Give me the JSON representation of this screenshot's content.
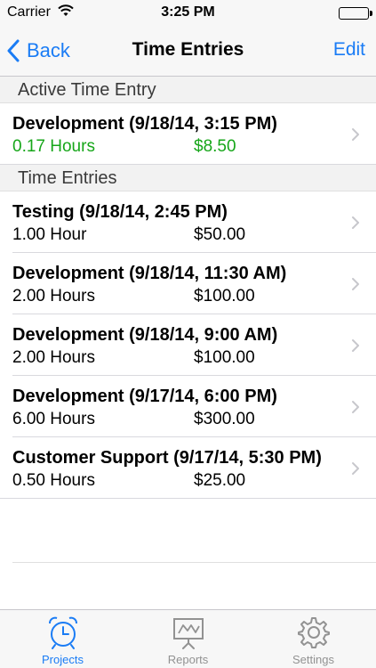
{
  "status_bar": {
    "carrier": "Carrier",
    "time": "3:25 PM"
  },
  "nav": {
    "back_label": "Back",
    "title": "Time Entries",
    "edit_label": "Edit"
  },
  "sections": {
    "active": {
      "header": "Active Time Entry",
      "entries": [
        {
          "title": "Development (9/18/14, 3:15 PM)",
          "hours": "0.17 Hours",
          "amount": "$8.50"
        }
      ]
    },
    "entries": {
      "header": "Time Entries",
      "entries": [
        {
          "title": "Testing (9/18/14, 2:45 PM)",
          "hours": "1.00 Hour",
          "amount": "$50.00"
        },
        {
          "title": "Development (9/18/14, 11:30 AM)",
          "hours": "2.00 Hours",
          "amount": "$100.00"
        },
        {
          "title": "Development (9/18/14, 9:00 AM)",
          "hours": "2.00 Hours",
          "amount": "$100.00"
        },
        {
          "title": "Development (9/17/14, 6:00 PM)",
          "hours": "6.00 Hours",
          "amount": "$300.00"
        },
        {
          "title": "Customer Support (9/17/14, 5:30 PM)",
          "hours": "0.50 Hours",
          "amount": "$25.00"
        }
      ]
    }
  },
  "tabs": [
    {
      "label": "Projects",
      "icon": "alarm-clock-icon",
      "selected": true
    },
    {
      "label": "Reports",
      "icon": "presentation-chart-icon",
      "selected": false
    },
    {
      "label": "Settings",
      "icon": "gear-icon",
      "selected": false
    }
  ],
  "colors": {
    "accent": "#1a7cf5",
    "active_green": "#16a619",
    "inactive_tab": "#929292"
  }
}
